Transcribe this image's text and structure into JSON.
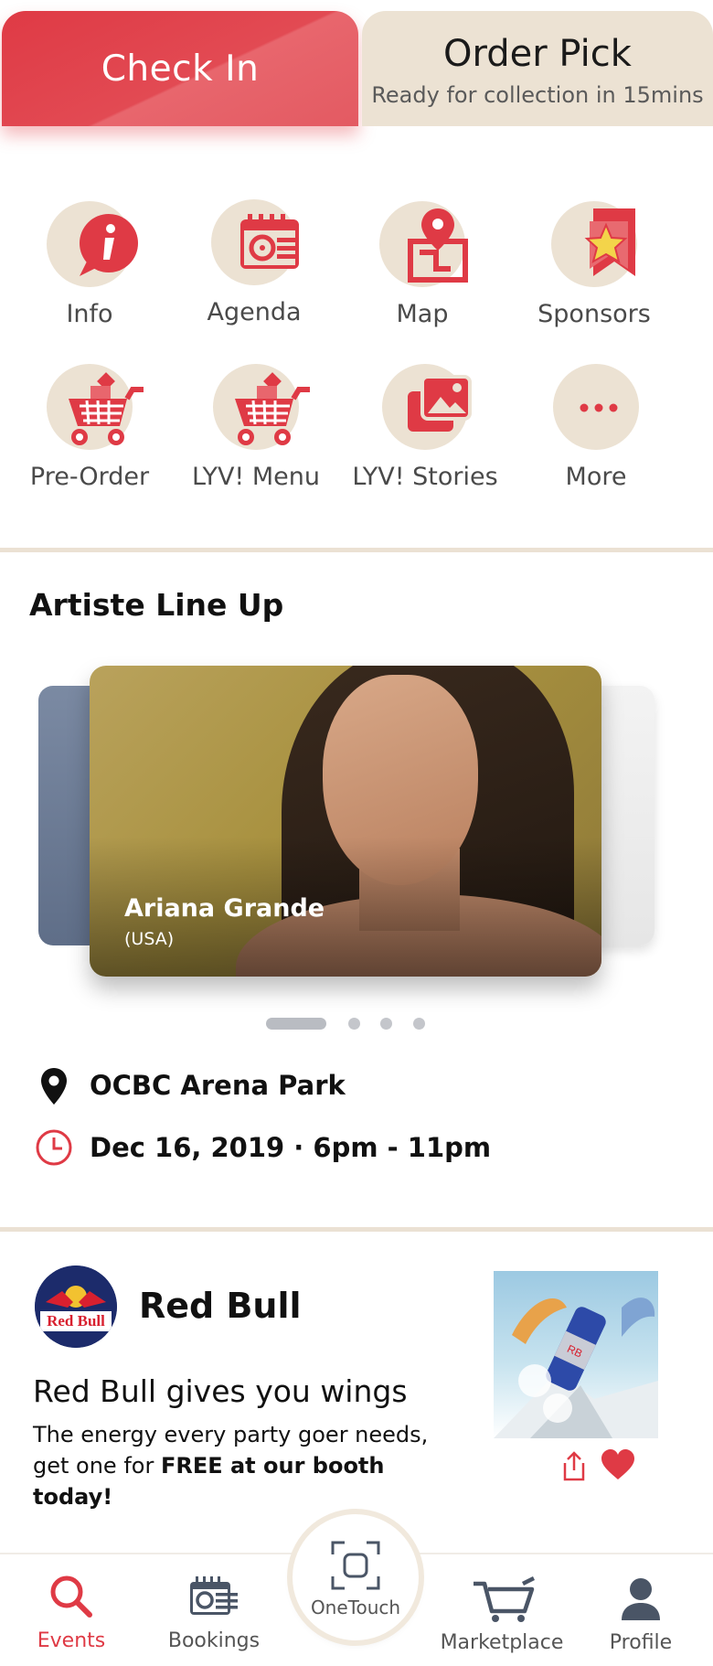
{
  "top_tabs": {
    "checkin_label": "Check In",
    "order_title": "Order Pick",
    "order_subtitle": "Ready for collection in 15mins"
  },
  "quick_actions": [
    {
      "label": "Info",
      "icon": "info-icon"
    },
    {
      "label": "Agenda",
      "icon": "agenda-icon"
    },
    {
      "label": "Map",
      "icon": "map-icon"
    },
    {
      "label": "Sponsors",
      "icon": "sponsors-icon"
    },
    {
      "label": "Pre-Order",
      "icon": "cart-icon"
    },
    {
      "label": "LYV! Menu",
      "icon": "cart-icon"
    },
    {
      "label": "LYV! Stories",
      "icon": "gallery-icon"
    },
    {
      "label": "More",
      "icon": "more-icon"
    }
  ],
  "lineup": {
    "title": "Artiste Line Up",
    "artist_name": "Ariana Grande",
    "artist_country": "(USA)",
    "page_count": 4,
    "current_page": 1
  },
  "event": {
    "location": "OCBC Arena Park",
    "datetime": "Dec 16, 2019 · 6pm - 11pm"
  },
  "promo": {
    "brand": "Red Bull",
    "headline": "Red Bull gives you wings",
    "body_prefix": "The energy every party goer needs, get one for ",
    "body_bold": "FREE at our booth today!",
    "logo_text": "Red Bull"
  },
  "bottom_nav": {
    "events": "Events",
    "bookings": "Bookings",
    "onetouch": "OneTouch",
    "marketplace": "Marketplace",
    "profile": "Profile"
  },
  "colors": {
    "accent": "#df3a45",
    "beige": "#ece2d3"
  }
}
